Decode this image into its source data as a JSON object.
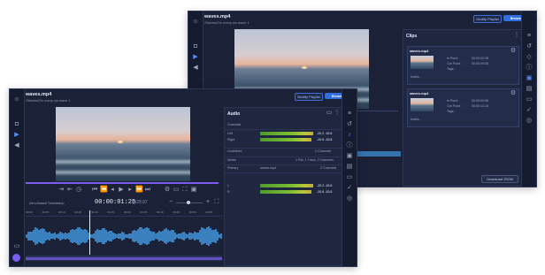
{
  "back_window": {
    "title": "waves.mp4",
    "subtitle": "/Stories/On every ws wave 1",
    "modify_playlist": "Modify Playlist",
    "browse": "Browse",
    "clips_title": "Clips",
    "clips": [
      {
        "name": "waves.mp4",
        "in_label": "In Point:",
        "in_value": "00:00:02:28",
        "out_label": "Out Point:",
        "out_value": "00:00:09:08",
        "tags_label": "Tags:",
        "notes": "Notes..."
      },
      {
        "name": "waves.mp4",
        "in_label": "In Point:",
        "in_value": "00:00:09:08",
        "out_label": "Out Point:",
        "out_value": "00:00:14:18",
        "tags_label": "Tags:",
        "notes": "Notes..."
      }
    ],
    "download_json": "Download JSON"
  },
  "front_window": {
    "title": "waves.mp4",
    "subtitle": "/Stories/On every ws wave 1",
    "modify_playlist": "Modify Playlist",
    "browse": "Browse",
    "timecode": "00:00:01:25",
    "frame_rate": "@29.97",
    "timeline_mode": "Zero-Based Timestamp",
    "ruler_ticks": [
      "00:00",
      "00:05",
      "00:10",
      "00:15",
      "00:20",
      "00:25",
      "00:30",
      "00:35",
      "00:40",
      "00:45",
      "00:50",
      "00:55"
    ],
    "audio": {
      "title": "Audio",
      "section1": "Channels",
      "left_label": "Left",
      "right_label": "Right",
      "left_db": "-20.2 -15.6",
      "right_db": "-20.6 -15.8",
      "undefined_label": "Undefined",
      "undefined_count": "2 Channels",
      "media_label": "Media",
      "media_info": "1 File, 1 Track, 2 Channels",
      "primary_label": "Primary",
      "primary_name": "waves.mp4",
      "primary_info": "2 Channels",
      "l_label": "L",
      "r_label": "R",
      "l_db": "-20.2 -15.6",
      "r_db": "-20.6 -15.8"
    }
  },
  "waveform_color": "#3f8fd6",
  "accent_color": "#2f6fe0",
  "progress_color": "#7a5cf0"
}
